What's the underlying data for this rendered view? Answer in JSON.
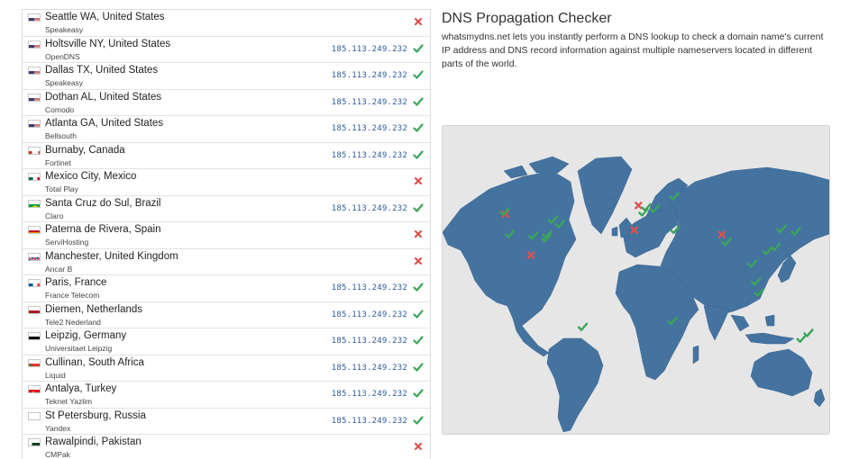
{
  "header": {
    "title": "DNS Propagation Checker",
    "description": "whatsmydns.net lets you instantly perform a DNS lookup to check a domain name's current IP address and DNS record information against multiple nameservers located in different parts of the world."
  },
  "colors": {
    "ip_text": "#2c5c97",
    "ok": "#3aa657",
    "fail": "#d9534f",
    "map_land": "#4473a0",
    "map_bg": "#e6e6e6"
  },
  "results": [
    {
      "location": "Seattle WA, United States",
      "provider": "Speakeasy",
      "ip": "",
      "status": "fail",
      "flag": "us"
    },
    {
      "location": "Holtsville NY, United States",
      "provider": "OpenDNS",
      "ip": "185.113.249.232",
      "status": "ok",
      "flag": "us"
    },
    {
      "location": "Dallas TX, United States",
      "provider": "Speakeasy",
      "ip": "185.113.249.232",
      "status": "ok",
      "flag": "us"
    },
    {
      "location": "Dothan AL, United States",
      "provider": "Comodo",
      "ip": "185.113.249.232",
      "status": "ok",
      "flag": "us"
    },
    {
      "location": "Atlanta GA, United States",
      "provider": "Bellsouth",
      "ip": "185.113.249.232",
      "status": "ok",
      "flag": "us"
    },
    {
      "location": "Burnaby, Canada",
      "provider": "Fortinet",
      "ip": "185.113.249.232",
      "status": "ok",
      "flag": "ca"
    },
    {
      "location": "Mexico City, Mexico",
      "provider": "Total Play",
      "ip": "",
      "status": "fail",
      "flag": "mx"
    },
    {
      "location": "Santa Cruz do Sul, Brazil",
      "provider": "Claro",
      "ip": "185.113.249.232",
      "status": "ok",
      "flag": "br"
    },
    {
      "location": "Paterna de Rivera, Spain",
      "provider": "ServiHosting",
      "ip": "",
      "status": "fail",
      "flag": "es"
    },
    {
      "location": "Manchester, United Kingdom",
      "provider": "Ancar B",
      "ip": "",
      "status": "fail",
      "flag": "gb"
    },
    {
      "location": "Paris, France",
      "provider": "France Telecom",
      "ip": "185.113.249.232",
      "status": "ok",
      "flag": "fr"
    },
    {
      "location": "Diemen, Netherlands",
      "provider": "Tele2 Nederland",
      "ip": "185.113.249.232",
      "status": "ok",
      "flag": "nl"
    },
    {
      "location": "Leipzig, Germany",
      "provider": "Universitaet Leipzig",
      "ip": "185.113.249.232",
      "status": "ok",
      "flag": "de"
    },
    {
      "location": "Cullinan, South Africa",
      "provider": "Liquid",
      "ip": "185.113.249.232",
      "status": "ok",
      "flag": "za"
    },
    {
      "location": "Antalya, Turkey",
      "provider": "Teknet Yazlim",
      "ip": "185.113.249.232",
      "status": "ok",
      "flag": "tr"
    },
    {
      "location": "St Petersburg, Russia",
      "provider": "Yandex",
      "ip": "185.113.249.232",
      "status": "ok",
      "flag": "ru"
    },
    {
      "location": "Rawalpindi, Pakistan",
      "provider": "CMPak",
      "ip": "",
      "status": "fail",
      "flag": "pk"
    }
  ],
  "map": {
    "markers": [
      {
        "status": "fail",
        "lon": -122.3,
        "lat": 47.6
      },
      {
        "status": "ok",
        "lon": -122.9,
        "lat": 49.25
      },
      {
        "status": "ok",
        "lon": -73.0,
        "lat": 40.8
      },
      {
        "status": "ok",
        "lon": -96.8,
        "lat": 32.8
      },
      {
        "status": "ok",
        "lon": -85.4,
        "lat": 31.2
      },
      {
        "status": "ok",
        "lon": -84.4,
        "lat": 33.7
      },
      {
        "status": "ok",
        "lon": -118.2,
        "lat": 34.0
      },
      {
        "status": "ok",
        "lon": -79.4,
        "lat": 43.7
      },
      {
        "status": "fail",
        "lon": -99.1,
        "lat": 19.4
      },
      {
        "status": "ok",
        "lon": -52.4,
        "lat": -29.7
      },
      {
        "status": "fail",
        "lon": -6.0,
        "lat": 36.6
      },
      {
        "status": "fail",
        "lon": -2.2,
        "lat": 53.5
      },
      {
        "status": "ok",
        "lon": 2.35,
        "lat": 48.85
      },
      {
        "status": "ok",
        "lon": 4.95,
        "lat": 52.3
      },
      {
        "status": "ok",
        "lon": 12.4,
        "lat": 51.3
      },
      {
        "status": "ok",
        "lon": 28.4,
        "lat": -25.7
      },
      {
        "status": "ok",
        "lon": 30.7,
        "lat": 36.9
      },
      {
        "status": "ok",
        "lon": 30.3,
        "lat": 59.9
      },
      {
        "status": "fail",
        "lon": 73.0,
        "lat": 33.6
      },
      {
        "status": "ok",
        "lon": 77.2,
        "lat": 28.6
      },
      {
        "status": "ok",
        "lon": 103.8,
        "lat": 1.35
      },
      {
        "status": "ok",
        "lon": 106.8,
        "lat": -6.2
      },
      {
        "status": "ok",
        "lon": 114.2,
        "lat": 22.3
      },
      {
        "status": "ok",
        "lon": 121.5,
        "lat": 25.0
      },
      {
        "status": "ok",
        "lon": 126.9,
        "lat": 37.5
      },
      {
        "status": "ok",
        "lon": 139.7,
        "lat": 35.7
      },
      {
        "status": "ok",
        "lon": 151.2,
        "lat": -33.9
      },
      {
        "status": "ok",
        "lon": 144.9,
        "lat": -37.8
      },
      {
        "status": "ok",
        "lon": 100.5,
        "lat": 13.7
      }
    ]
  }
}
